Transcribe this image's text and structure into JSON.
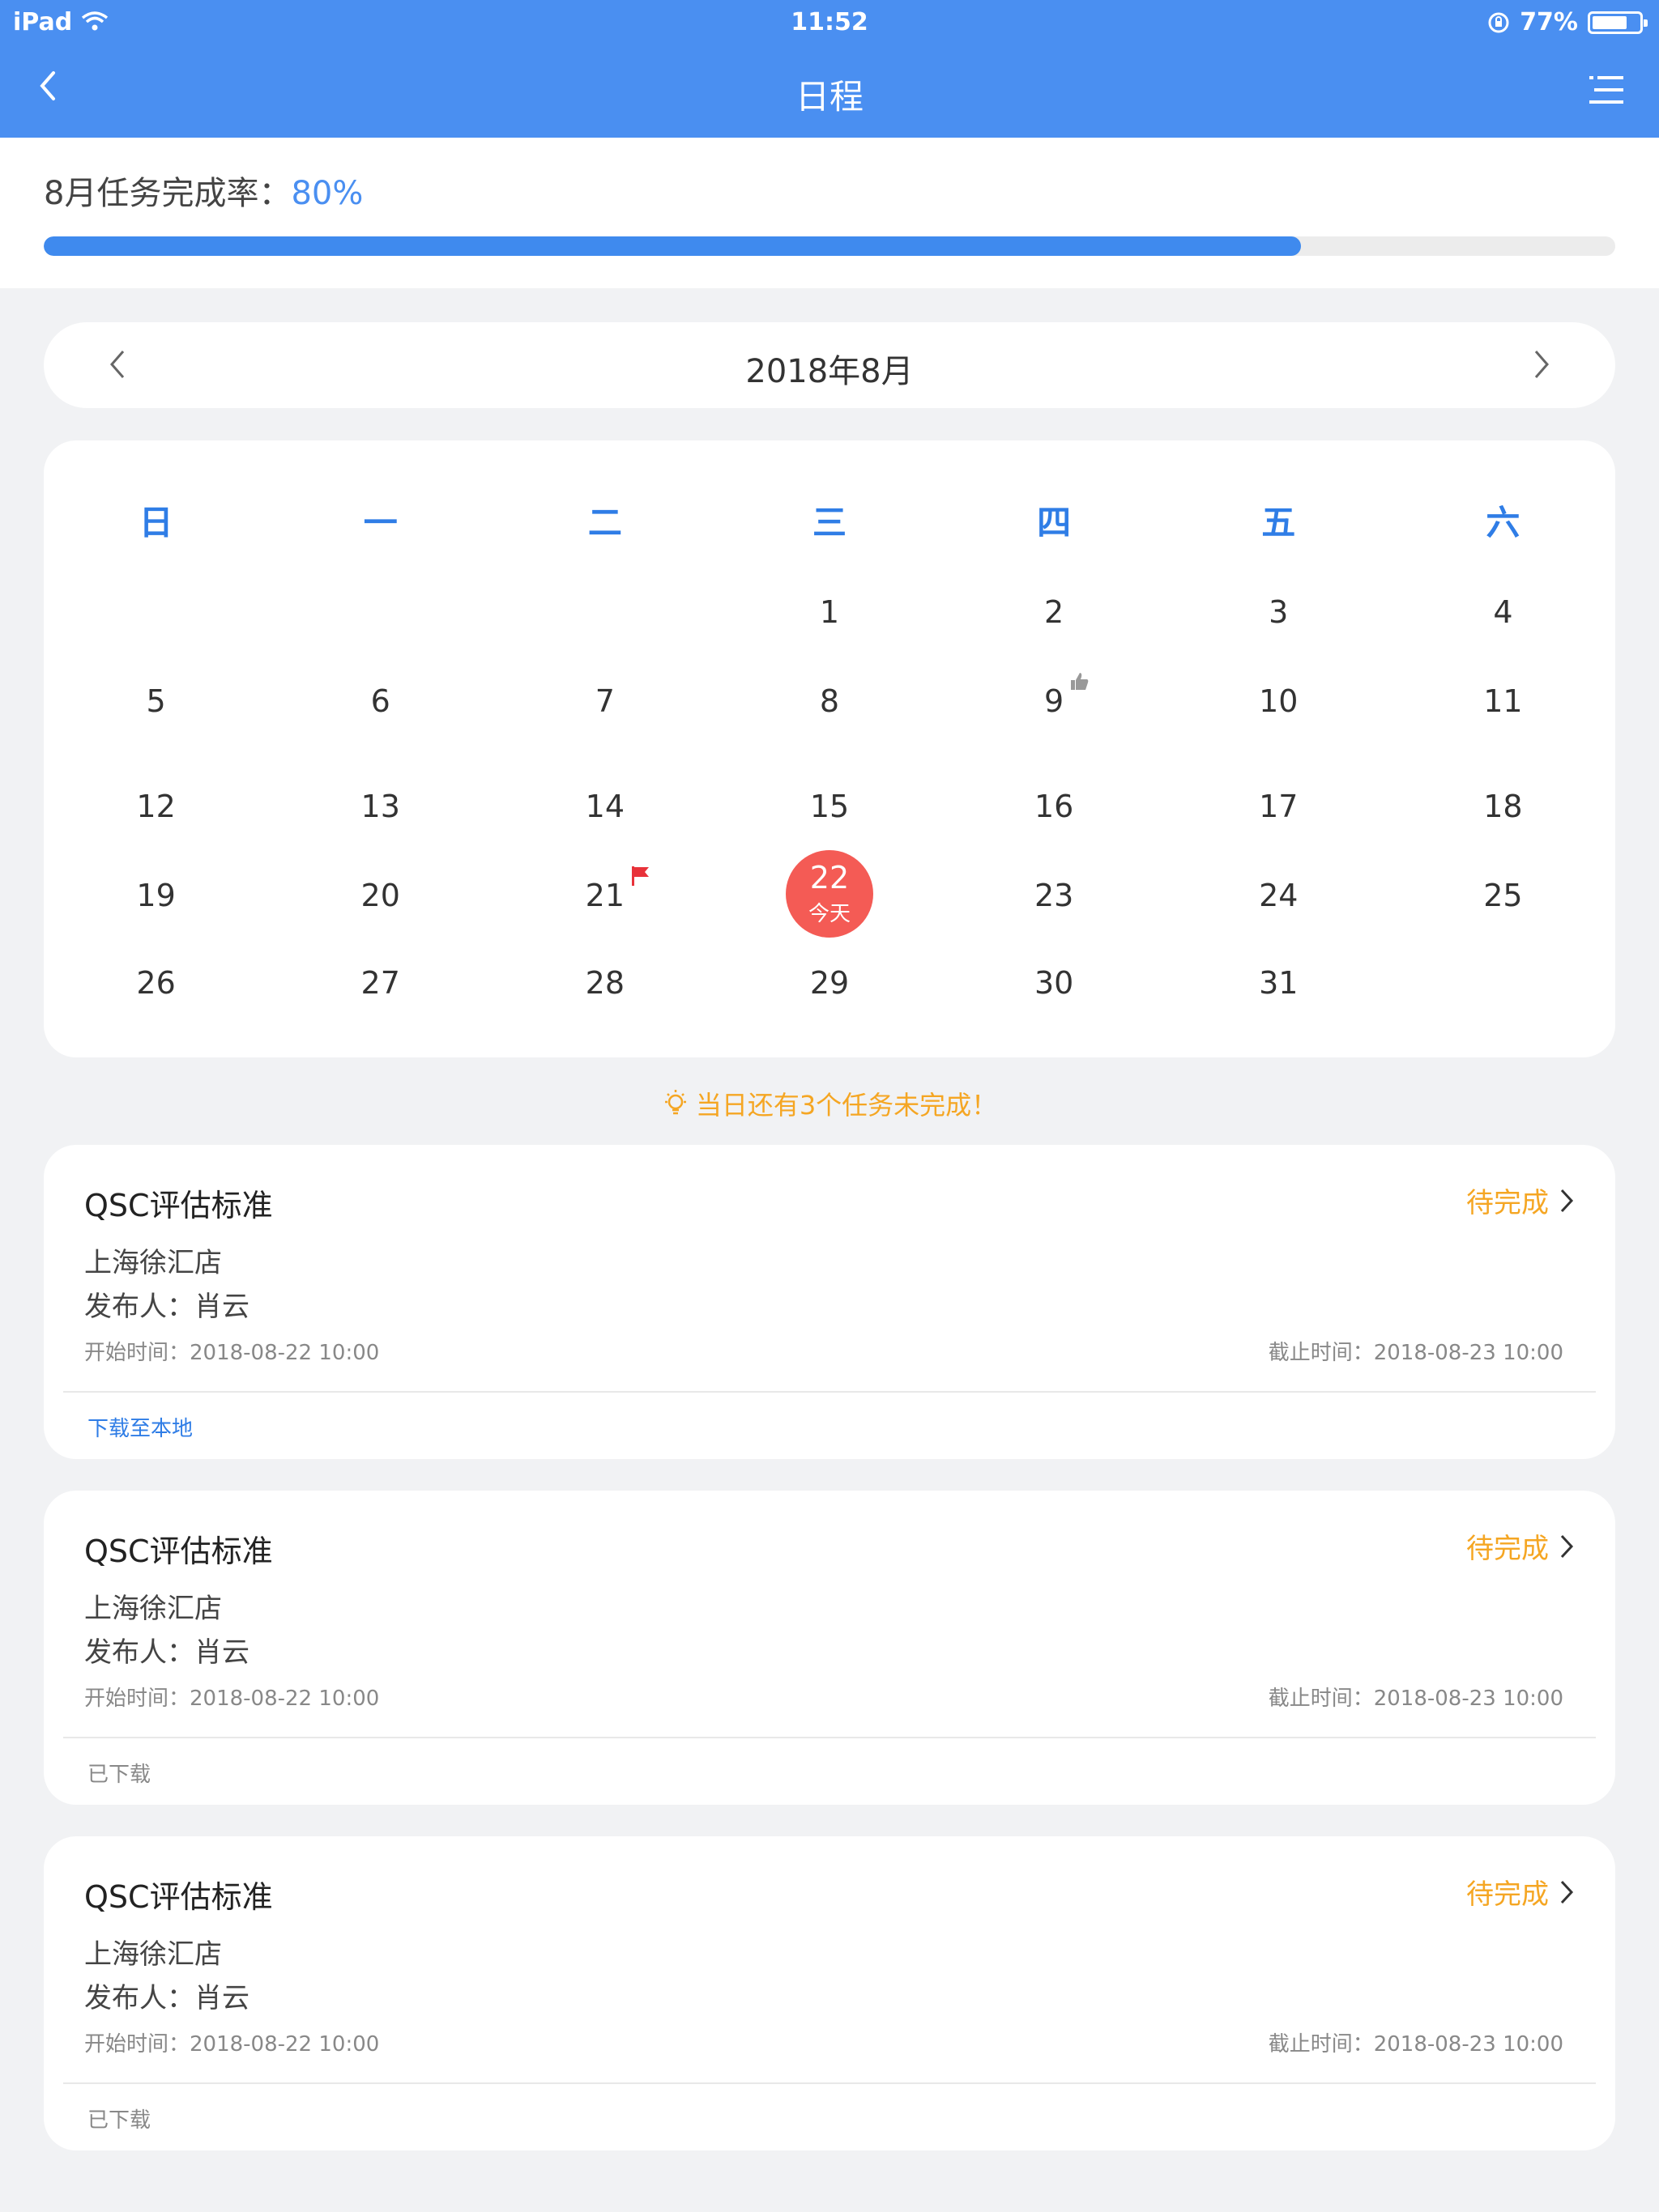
{
  "status_bar": {
    "carrier": "iPad",
    "time": "11:52",
    "battery_text": "77%",
    "battery_level": 0.77
  },
  "navbar": {
    "title": "日程",
    "back_icon": "chevron-left-icon",
    "menu_icon": "list-menu-icon"
  },
  "progress": {
    "label": "8月任务完成率：",
    "percent_text": "80%",
    "value": 0.8
  },
  "month": {
    "label": "2018年8月"
  },
  "calendar": {
    "weekdays": [
      "日",
      "一",
      "二",
      "三",
      "四",
      "五",
      "六"
    ],
    "weeks": [
      [
        "",
        "",
        "",
        "1",
        "2",
        "3",
        "4"
      ],
      [
        "5",
        "6",
        "7",
        "8",
        "9",
        "10",
        "11"
      ],
      [
        "12",
        "13",
        "14",
        "15",
        "16",
        "17",
        "18"
      ],
      [
        "19",
        "20",
        "21",
        "22",
        "23",
        "24",
        "25"
      ],
      [
        "26",
        "27",
        "28",
        "29",
        "30",
        "31",
        ""
      ]
    ],
    "today": {
      "day": "22",
      "label": "今天"
    },
    "marks": {
      "9": "thumbs-up-icon",
      "21": "red-flag-icon"
    }
  },
  "hint": {
    "text": "当日还有3个任务未完成！",
    "icon": "lightbulb-icon"
  },
  "tasks": [
    {
      "title": "QSC评估标准",
      "status": "待完成",
      "store": "上海徐汇店",
      "publisher": "发布人：肖云",
      "start": "开始时间：2018-08-22  10:00",
      "end": "截止时间：2018-08-23  10:00",
      "action": "下载至本地"
    },
    {
      "title": "QSC评估标准",
      "status": "待完成",
      "store": "上海徐汇店",
      "publisher": "发布人：肖云",
      "start": "开始时间：2018-08-22  10:00",
      "end": "截止时间：2018-08-23  10:00",
      "action": "已下载"
    },
    {
      "title": "QSC评估标准",
      "status": "待完成",
      "store": "上海徐汇店",
      "publisher": "发布人：肖云",
      "start": "开始时间：2018-08-22  10:00",
      "end": "截止时间：2018-08-23  10:00",
      "action": "已下载"
    }
  ],
  "colors": {
    "primary": "#4a8ff1",
    "today": "#f45b55",
    "warning": "#f5a623",
    "flag": "#e8323a"
  }
}
